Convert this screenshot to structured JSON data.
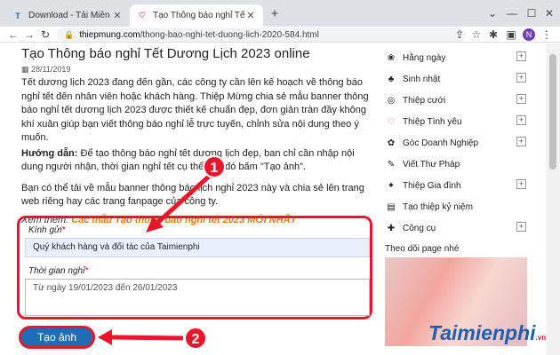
{
  "browser": {
    "tabs": [
      {
        "label": "Download - Tải Miễn Phí VN - Ph",
        "favicon": "T",
        "active": false
      },
      {
        "label": "Tạo Thông báo nghỉ Tết Dương lị",
        "favicon": "heart",
        "active": true
      }
    ],
    "new_tab": "+",
    "url_host": "thiepmung.com",
    "url_path": "/thong-bao-nghi-tet-duong-lich-2020-584.html",
    "profile_initial": "N"
  },
  "article": {
    "title": "Tạo Thông báo nghỉ Tết Dương Lịch 2023 online",
    "date": "28/11/2019",
    "intro": "Tết dương lịch 2023 đang đến gần, các công ty cần lên kế hoạch về thông báo nghỉ tết đến nhân viên hoặc khách hàng. Thiệp Mừng chia sẻ mẫu banner thông báo nghỉ tết dương lịch 2023 được thiết kế chuẩn đẹp, đơn giản tràn đầy không khí xuân giúp bạn viết thông báo nghỉ lễ trực tuyến, chỉnh sửa nội dung theo ý muốn.",
    "guide_label": "Hướng dẫn:",
    "guide_text": " Để tạo thông báo nghỉ tết dương lịch đẹp, ban chỉ cần nhập nội dung người nhận, thời gian nghỉ tết cụ thể sau đó bấm \"Tạo ảnh\".",
    "share": "Bạn có thể tải về mẫu banner thông báo lịch nghỉ 2023 này và chia sẻ lên trang web riêng hay các trang fanpage của công ty.",
    "see_more_label": "Xem thêm:",
    "see_more_link": "Các mẫu Tạo thông báo nghỉ tết 2023 MỚI NHẤT"
  },
  "form": {
    "recipient_label": "Kính gửi",
    "recipient_value": "Quý khách hàng và đối tác của Taimienphi",
    "time_label": "Thời gian nghỉ",
    "time_value": "Từ ngày 19/01/2023 đến 26/01/2023",
    "required_mark": "*",
    "submit_label": "Tạo ảnh"
  },
  "sidebar": {
    "items": [
      {
        "label": "Hằng ngày",
        "icon": "sun-icon"
      },
      {
        "label": "Sinh nhật",
        "icon": "cake-icon"
      },
      {
        "label": "Thiệp cưới",
        "icon": "rings-icon"
      },
      {
        "label": "Thiệp Tình yêu",
        "icon": "heart-icon"
      },
      {
        "label": "Góc Doanh Nghiệp",
        "icon": "gift-icon"
      },
      {
        "label": "Viết Thư Pháp",
        "icon": "brush-icon"
      },
      {
        "label": "Thiệp Gia đình",
        "icon": "family-icon"
      },
      {
        "label": "Tạo thiệp kỷ niệm",
        "icon": "album-icon"
      },
      {
        "label": "Công cụ",
        "icon": "tools-icon"
      }
    ],
    "follow_title": "Theo dõi page nhé"
  },
  "annotations": {
    "step1": "1",
    "step2": "2"
  },
  "watermark": {
    "brand": "Taimienphi",
    "suffix": ".vn"
  },
  "colors": {
    "accent_red": "#e8172b",
    "button_blue": "#1f6eb5",
    "link_orange": "#e07a10"
  }
}
